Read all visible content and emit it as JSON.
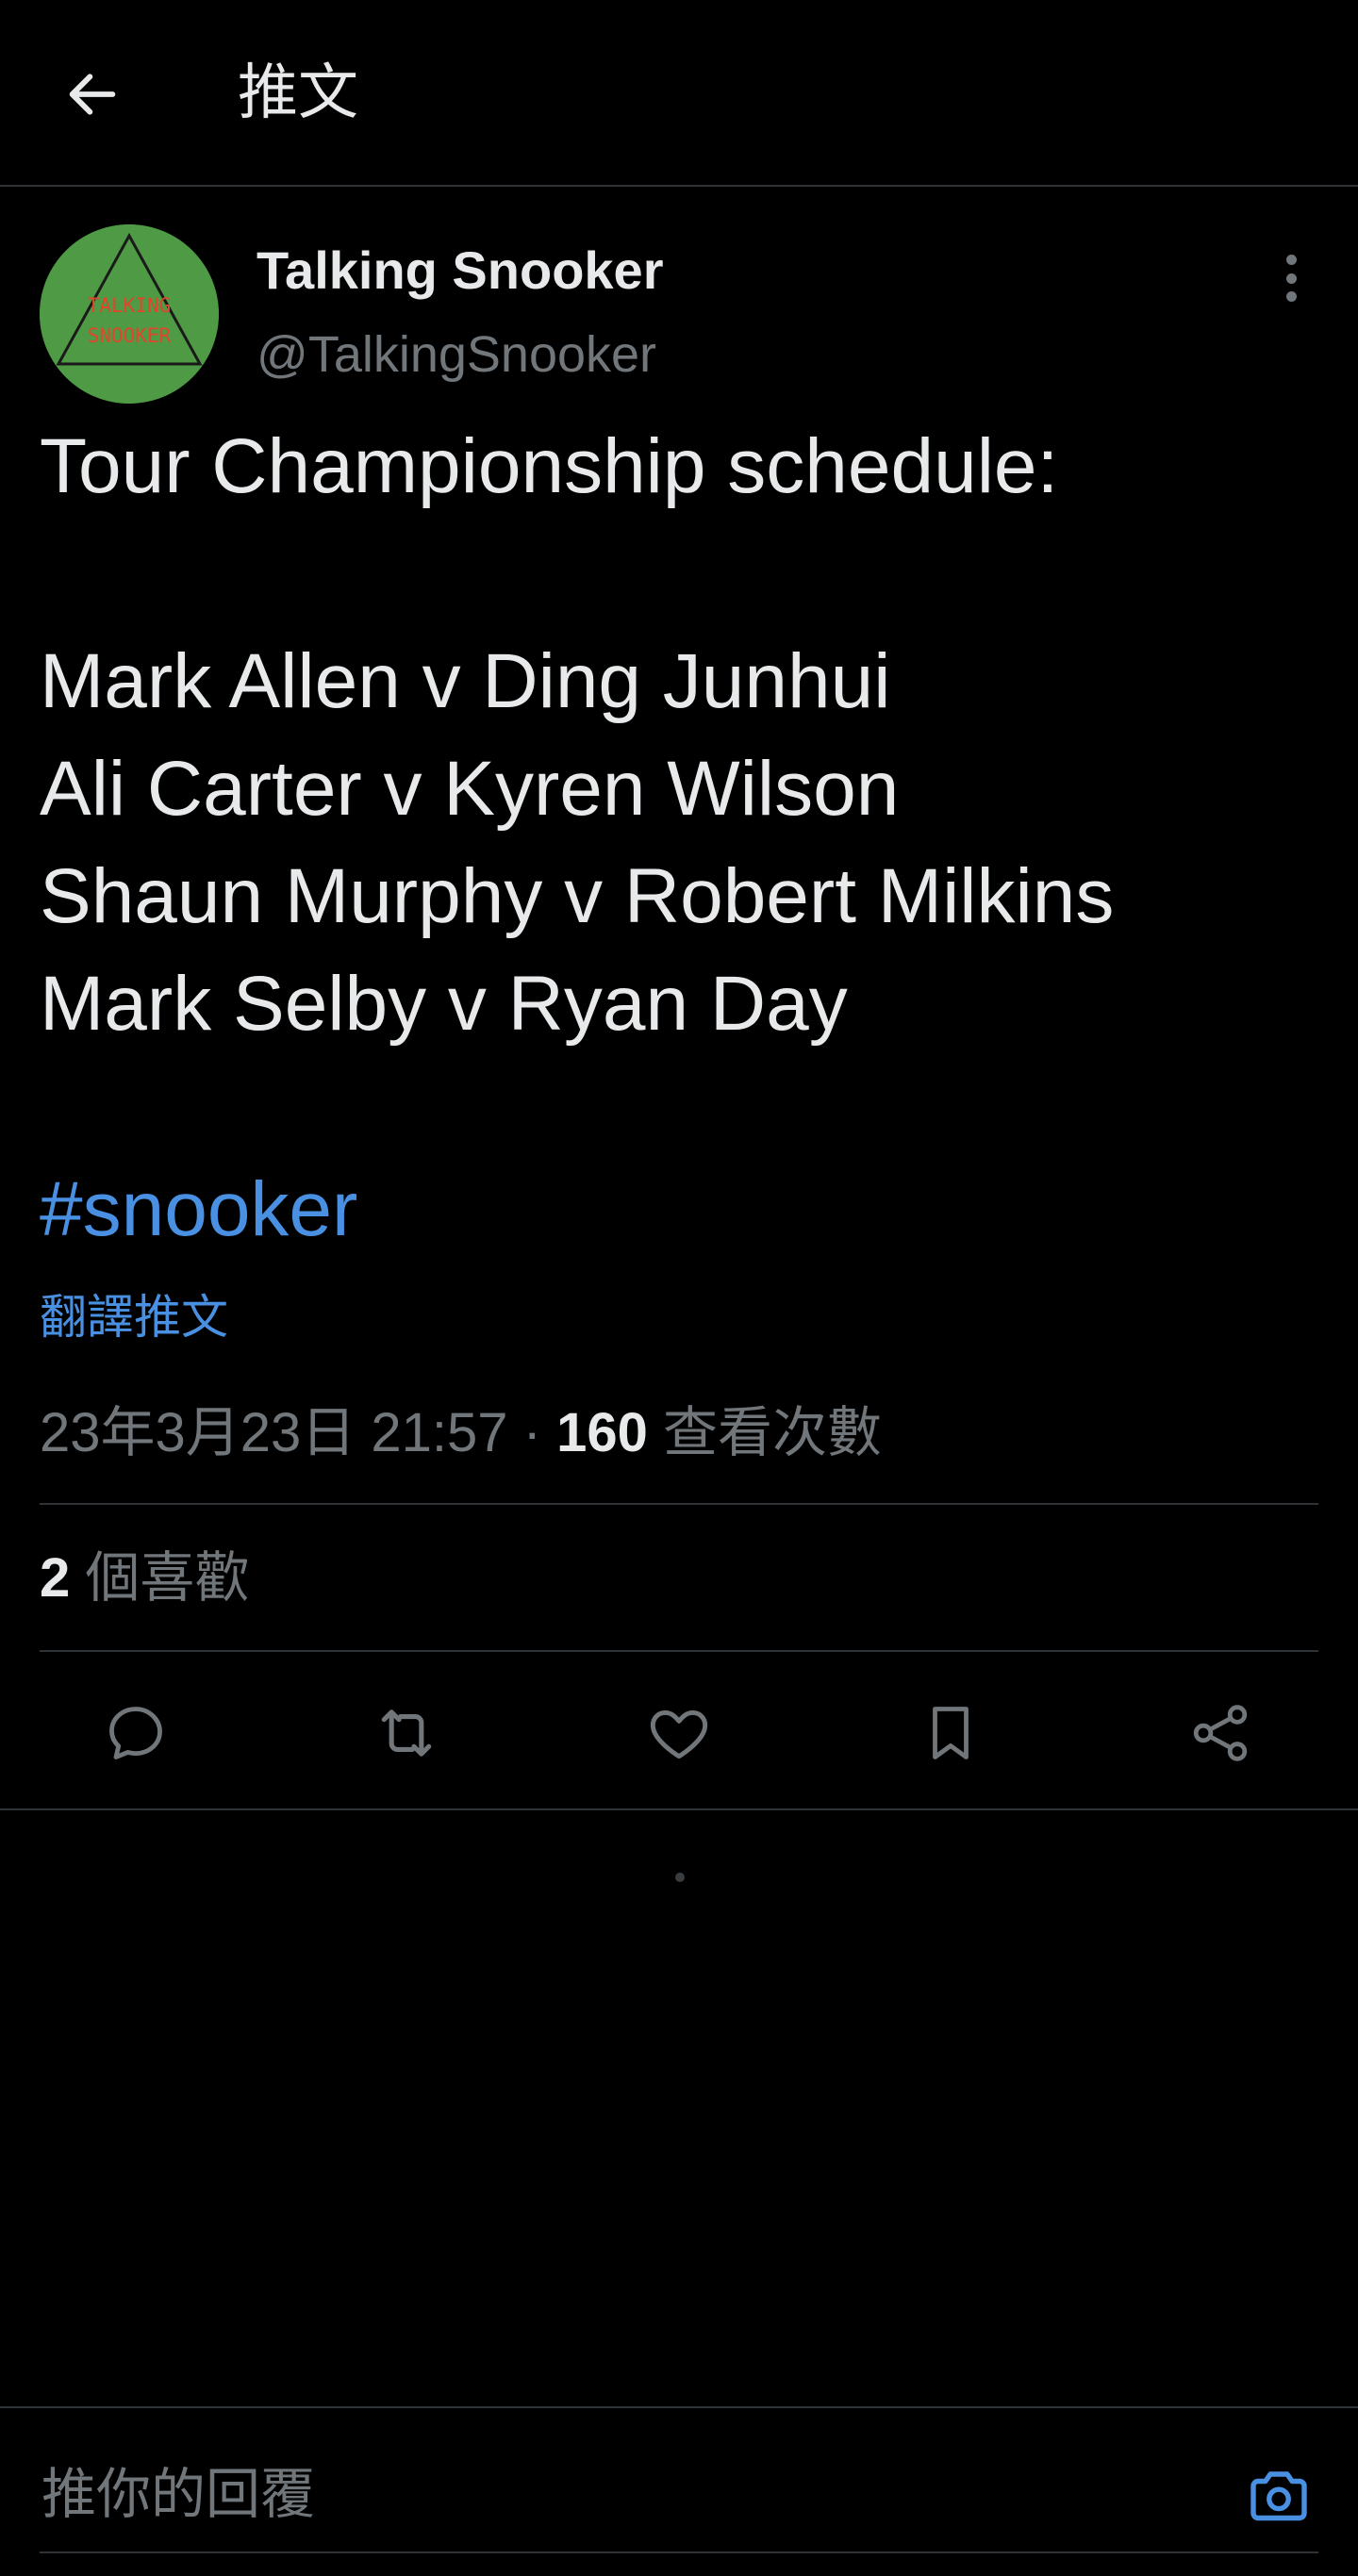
{
  "header": {
    "title": "推文"
  },
  "author": {
    "name": "Talking Snooker",
    "handle": "@TalkingSnooker",
    "avatar_text_line1": "TALKING",
    "avatar_text_line2": "SNOOKER"
  },
  "tweet": {
    "text": "Tour Championship schedule:\n\nMark Allen v Ding Junhui\nAli Carter v Kyren Wilson\nShaun Murphy v Robert Milkins\nMark Selby v Ryan Day",
    "hashtag": "#snooker",
    "translate_label": "翻譯推文",
    "timestamp": "23年3月23日 21:57",
    "separator": "·",
    "views_count": "160",
    "views_label": "查看次數"
  },
  "stats": {
    "likes_count": "2",
    "likes_label": "個喜歡"
  },
  "actions": [
    "reply-icon",
    "retweet-icon",
    "like-icon",
    "bookmark-icon",
    "share-icon"
  ],
  "reply": {
    "placeholder": "推你的回覆"
  },
  "colors": {
    "background": "#000000",
    "text": "#e7e9ea",
    "muted": "#71767b",
    "accent": "#4a90e2",
    "avatar_bg": "#4f9a45"
  }
}
